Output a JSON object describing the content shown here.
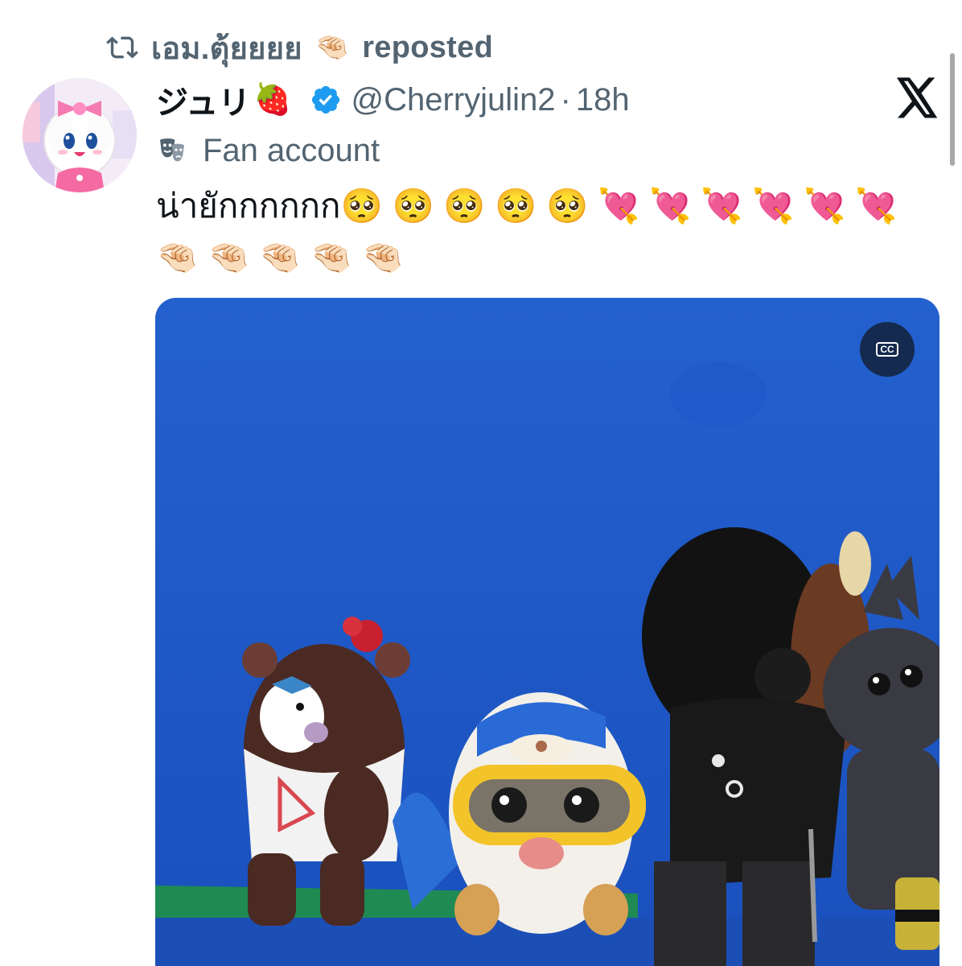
{
  "repost": {
    "icon": "repost-icon",
    "reposter_name": "เอม.ตุ้ยยยย",
    "reposter_emoji": "🤏🏻",
    "label": "reposted"
  },
  "tweet": {
    "author_name": "ジュリ",
    "author_emoji": "🍓",
    "verified_color": "#1d9bf0",
    "handle": "@Cherryjulin2",
    "separator": "·",
    "time": "18h",
    "label_icon": "theater-masks-icon",
    "label": "Fan account",
    "text": "น่ายักกกกกก🥺 🥺 🥺 🥺 🥺 💘 💘 💘 💘 💘 💘 🤏🏻 🤏🏻 🤏🏻 🤏🏻 🤏🏻"
  },
  "media": {
    "type": "video",
    "cc_label": "CC",
    "background_color": "#1a54c4"
  },
  "app": {
    "logo": "x-logo-icon"
  }
}
